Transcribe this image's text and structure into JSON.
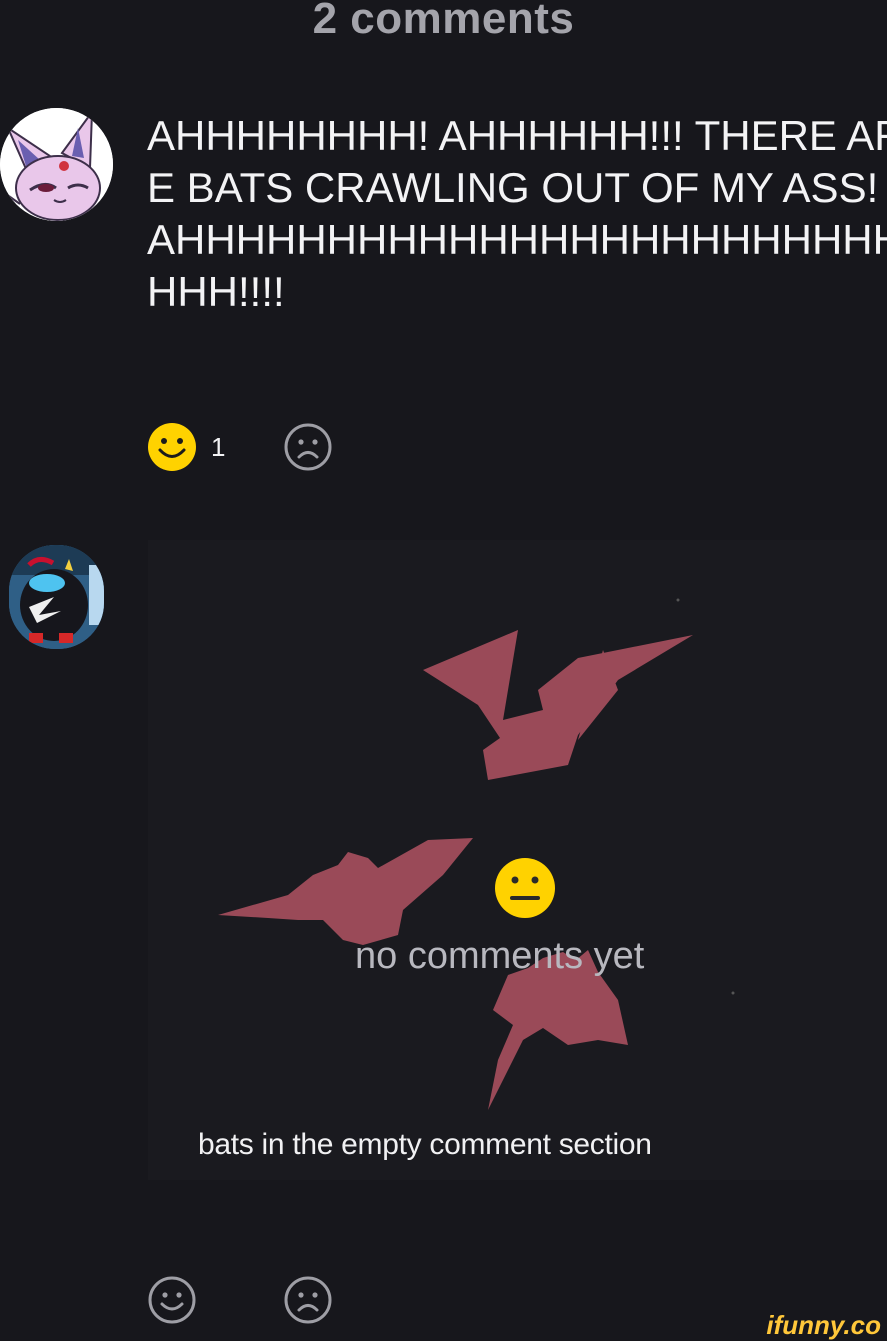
{
  "header": {
    "title": "2 comments"
  },
  "comments": [
    {
      "avatar": "espeon-avatar",
      "text": "AHHHHHHHH! AHHHHHH!!! THERE ARE BATS CRAWLING OUT OF MY ASS! AHHHHHHHHHHHHHHHHHHHHHHHHHHH!!!!",
      "reactions": {
        "smile_count": "1",
        "smile_icon": "smile-icon",
        "frown_icon": "frown-icon"
      }
    },
    {
      "avatar": "plush-avatar",
      "image": {
        "placeholder_text": "no comments yet",
        "caption": "bats in the empty comment section",
        "icons": [
          "bat-icon",
          "neutral-face-icon"
        ]
      },
      "reactions": {
        "smile_icon": "smile-outline-icon",
        "frown_icon": "frown-icon"
      }
    }
  ],
  "colors": {
    "background": "#17171c",
    "bat": "#9a4a58",
    "emoji": "#ffd200",
    "watermark": "#ffc73a"
  },
  "watermark": "ifunny.co"
}
